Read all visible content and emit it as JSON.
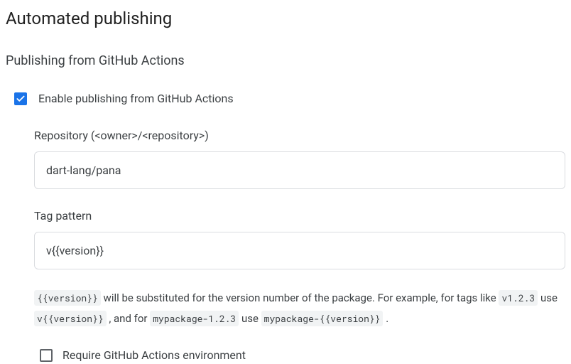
{
  "page": {
    "title": "Automated publishing",
    "section_title": "Publishing from GitHub Actions"
  },
  "enable": {
    "label": "Enable publishing from GitHub Actions",
    "checked": true
  },
  "repository": {
    "label": "Repository (<owner>/<repository>)",
    "value": "dart-lang/pana"
  },
  "tag_pattern": {
    "label": "Tag pattern",
    "value": "v{{version}}"
  },
  "help": {
    "code1": "{{version}}",
    "text1": " will be substituted for the version number of the package. For example, for tags like ",
    "code2": "v1.2.3",
    "text2": " use ",
    "code3": "v{{version}}",
    "text3": " , and for ",
    "code4": "mypackage-1.2.3",
    "text4": " use ",
    "code5": "mypackage-{{version}}",
    "text5": " ."
  },
  "require_env": {
    "label": "Require GitHub Actions environment",
    "checked": false
  }
}
